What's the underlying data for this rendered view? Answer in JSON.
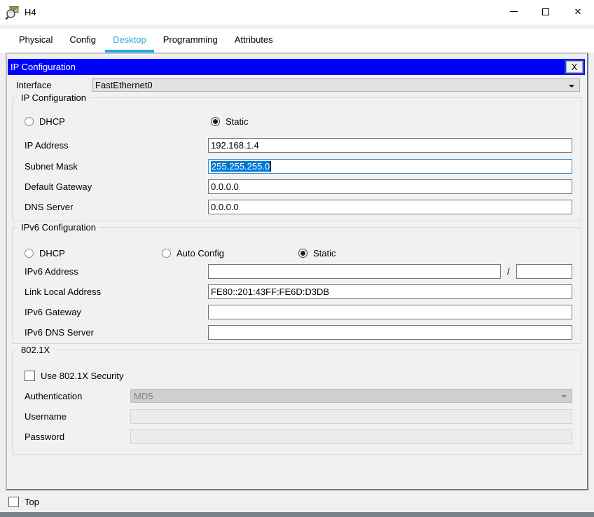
{
  "window": {
    "title": "H4"
  },
  "icons": {
    "app": "packet-tracer-magnifier-envelope",
    "minimize": "—",
    "maximize": "▢",
    "close": "✕",
    "dropdown": "▼"
  },
  "tabs": [
    {
      "label": "Physical",
      "active": false
    },
    {
      "label": "Config",
      "active": false
    },
    {
      "label": "Desktop",
      "active": true
    },
    {
      "label": "Programming",
      "active": false
    },
    {
      "label": "Attributes",
      "active": false
    }
  ],
  "dialog": {
    "title": "IP Configuration",
    "close_label": "X",
    "interface": {
      "label": "Interface",
      "value": "FastEthernet0"
    },
    "ip_config": {
      "group_label": "IP Configuration",
      "dhcp": {
        "label": "DHCP",
        "selected": false
      },
      "static": {
        "label": "Static",
        "selected": true
      },
      "ip_address": {
        "label": "IP Address",
        "value": "192.168.1.4"
      },
      "subnet_mask": {
        "label": "Subnet Mask",
        "value": "255.255.255.0",
        "focused": true,
        "text_selected": true
      },
      "default_gateway": {
        "label": "Default Gateway",
        "value": "0.0.0.0"
      },
      "dns_server": {
        "label": "DNS Server",
        "value": "0.0.0.0"
      }
    },
    "ipv6_config": {
      "group_label": "IPv6 Configuration",
      "dhcp": {
        "label": "DHCP",
        "selected": false
      },
      "auto_config": {
        "label": "Auto Config",
        "selected": false
      },
      "static": {
        "label": "Static",
        "selected": true
      },
      "ipv6_address": {
        "label": "IPv6 Address",
        "value": "",
        "separator": "/",
        "prefix": ""
      },
      "link_local": {
        "label": "Link Local Address",
        "value": "FE80::201:43FF:FE6D:D3DB"
      },
      "ipv6_gateway": {
        "label": "IPv6 Gateway",
        "value": ""
      },
      "ipv6_dns": {
        "label": "IPv6 DNS Server",
        "value": ""
      }
    },
    "dot1x": {
      "group_label": "802.1X",
      "use_security": {
        "label": "Use 802.1X Security",
        "checked": false
      },
      "authentication": {
        "label": "Authentication",
        "value": "MD5",
        "disabled": true
      },
      "username": {
        "label": "Username",
        "value": "",
        "disabled": true
      },
      "password": {
        "label": "Password",
        "value": "",
        "disabled": true
      }
    }
  },
  "footer": {
    "top": {
      "label": "Top",
      "checked": false
    }
  },
  "colors": {
    "header_bg": "#0000ff",
    "active_tab": "#2aa9dd",
    "selection_bg": "#0078d7",
    "focus_border": "#3390df",
    "bottom_strip": "#7b828c"
  }
}
